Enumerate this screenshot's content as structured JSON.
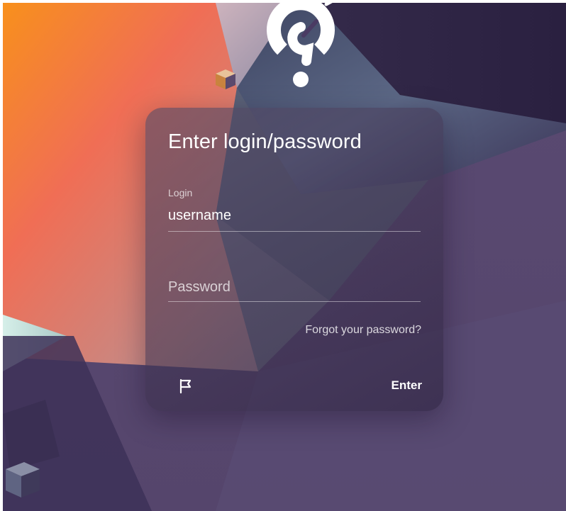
{
  "colors": {
    "background_primary": "#4a3b63",
    "background_orange": "#f58a1f",
    "background_coral": "#ef6d5a",
    "background_slate": "#4f5a7a",
    "card": "#342848",
    "text": "#ffffff"
  },
  "logo": {
    "icon": "question-mark-brand-logo"
  },
  "login_card": {
    "title": "Enter login/password",
    "login": {
      "label": "Login",
      "value": "username"
    },
    "password": {
      "placeholder": "Password",
      "value": ""
    },
    "forgot_password_label": "Forgot your password?",
    "language_icon": "flag-icon",
    "enter_label": "Enter"
  }
}
